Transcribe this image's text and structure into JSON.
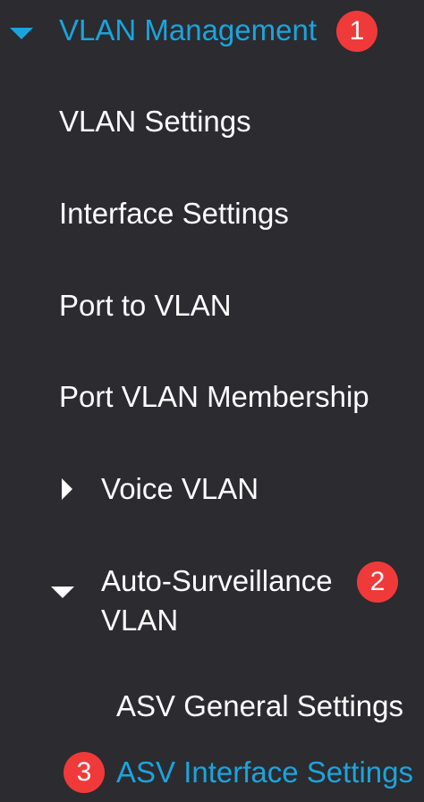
{
  "nav": {
    "vlan_management": {
      "label": "VLAN Management",
      "badge": "1",
      "icon": "caret-down-icon",
      "color": "#1ba4dc"
    },
    "vlan_settings": {
      "label": "VLAN Settings"
    },
    "interface_settings": {
      "label": "Interface Settings"
    },
    "port_to_vlan": {
      "label": "Port to VLAN"
    },
    "port_vlan_membership": {
      "label": "Port VLAN Membership"
    },
    "voice_vlan": {
      "label": "Voice VLAN",
      "icon": "caret-right-icon"
    },
    "auto_surveillance_vlan": {
      "label_line1": "Auto-Surveillance",
      "label_line2": "VLAN",
      "badge": "2",
      "icon": "caret-down-icon"
    },
    "asv_general_settings": {
      "label": "ASV General Settings"
    },
    "asv_interface_settings": {
      "label": "ASV Interface Settings",
      "badge": "3",
      "color": "#1ba4dc"
    }
  },
  "colors": {
    "background": "#2b2b30",
    "accent": "#1ba4dc",
    "badge": "#f03a3a",
    "text": "#ffffff"
  }
}
